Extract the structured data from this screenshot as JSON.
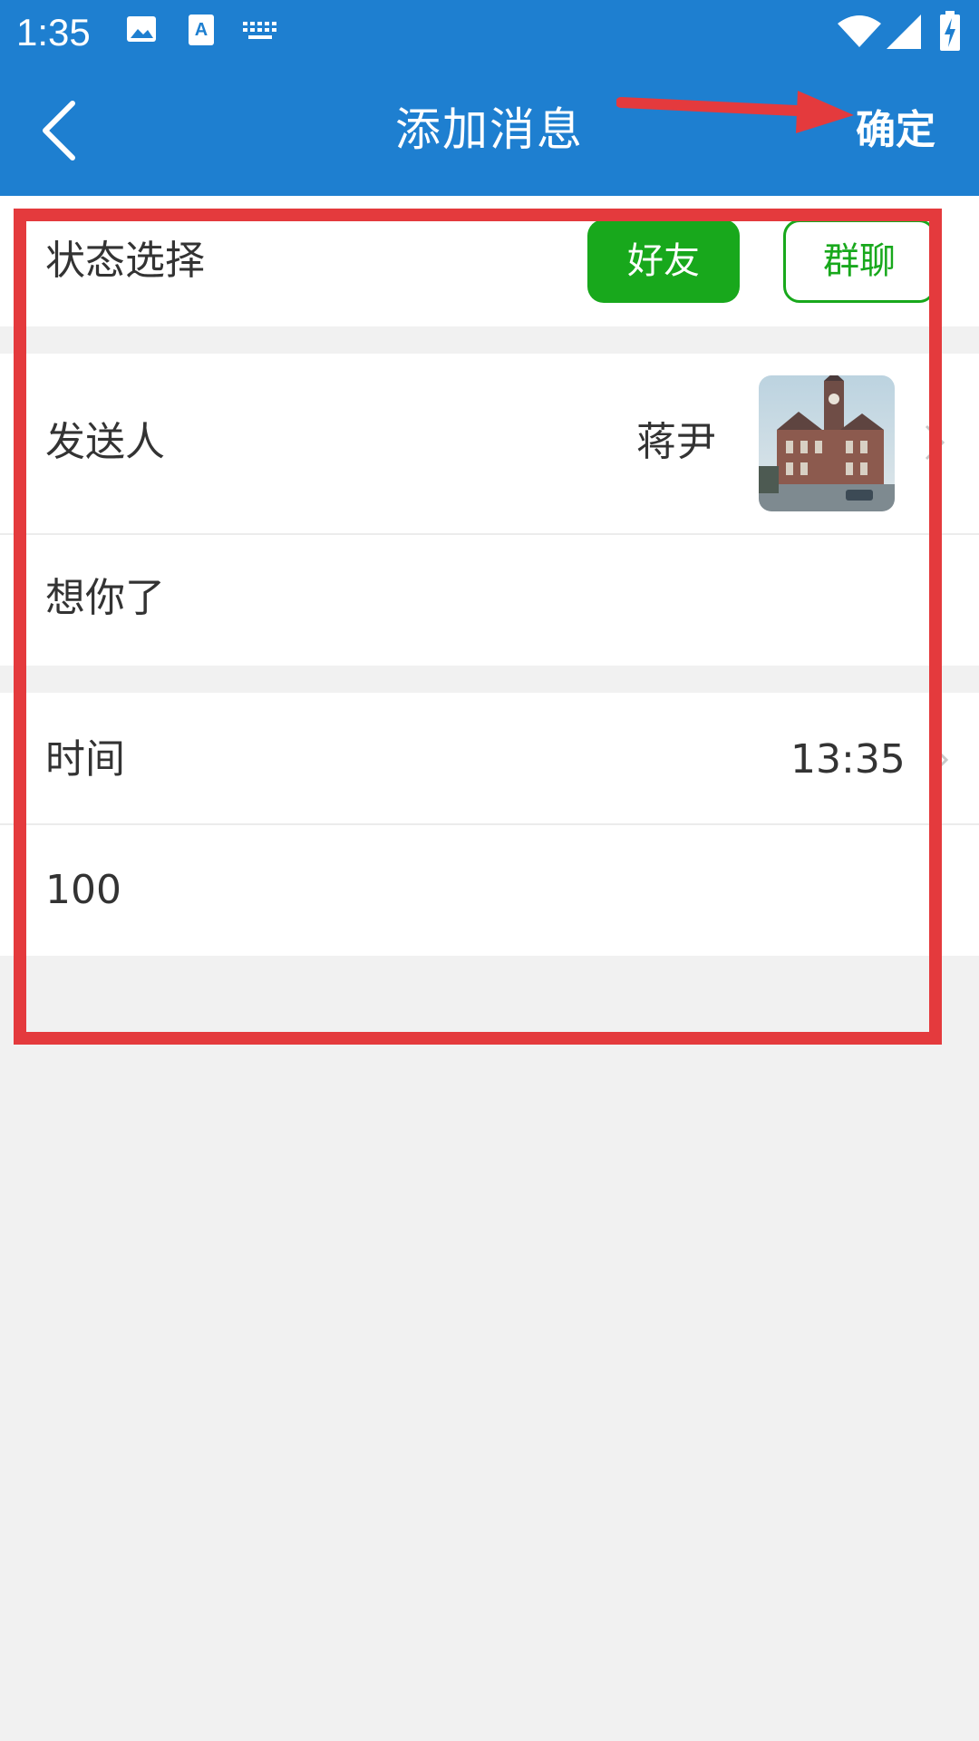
{
  "status_bar": {
    "time": "1:35",
    "icons": [
      "image-icon",
      "text-input-icon",
      "keyboard-icon",
      "wifi-icon",
      "cell-signal-icon",
      "battery-charging-icon"
    ]
  },
  "app_bar": {
    "title": "添加消息",
    "back_icon": "back-arrow-icon",
    "confirm_label": "确定"
  },
  "status_select": {
    "label": "状态选择",
    "options": [
      "好友",
      "群聊"
    ],
    "selected": "好友"
  },
  "sender": {
    "label": "发送人",
    "name": "蒋尹",
    "avatar": "building-clock-tower-photo"
  },
  "message": {
    "text": "想你了"
  },
  "time_row": {
    "label": "时间",
    "value": "13:35"
  },
  "amount": {
    "value": "100"
  },
  "colors": {
    "primary": "#1e7fd0",
    "accent_green": "#18a81c",
    "annotation_red": "#e43a3d",
    "background": "#f1f1f1"
  }
}
